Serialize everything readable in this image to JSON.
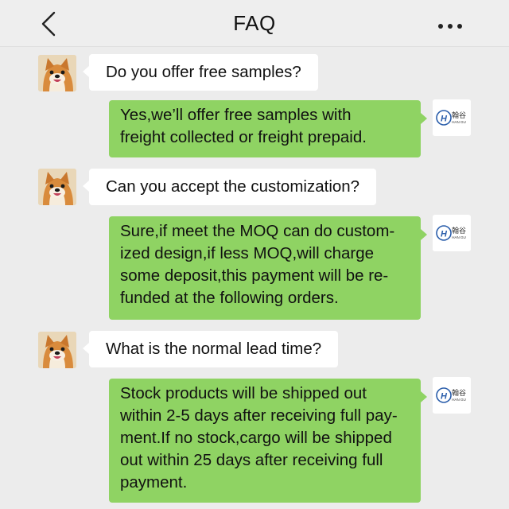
{
  "header": {
    "title": "FAQ",
    "back_icon": "chevron-left-icon",
    "menu_icon": "more-dots-icon"
  },
  "logo": {
    "text_cn": "翰谷",
    "text_en": "HAN GU"
  },
  "messages": [
    {
      "question": "Do you offer free samples?",
      "answer_lines": [
        "Yes,we’ll offer free samples with",
        "freight collected or freight prepaid."
      ]
    },
    {
      "question": "Can you accept the customization?",
      "answer_lines": [
        "Sure,if meet the MOQ can do custom-",
        "ized design,if less MOQ,will charge",
        "some deposit,this payment will be re-",
        "funded at the following orders."
      ]
    },
    {
      "question": "What is the normal lead time?",
      "answer_lines": [
        "Stock products will be shipped out",
        "within 2-5 days after receiving full pay-",
        "ment.If no stock,cargo will be shipped",
        "out within 25 days after receiving full",
        "payment."
      ]
    }
  ],
  "colors": {
    "background": "#ececec",
    "answer_bubble": "#8fd363",
    "question_bubble": "#ffffff",
    "logo_blue": "#2b5eab"
  }
}
